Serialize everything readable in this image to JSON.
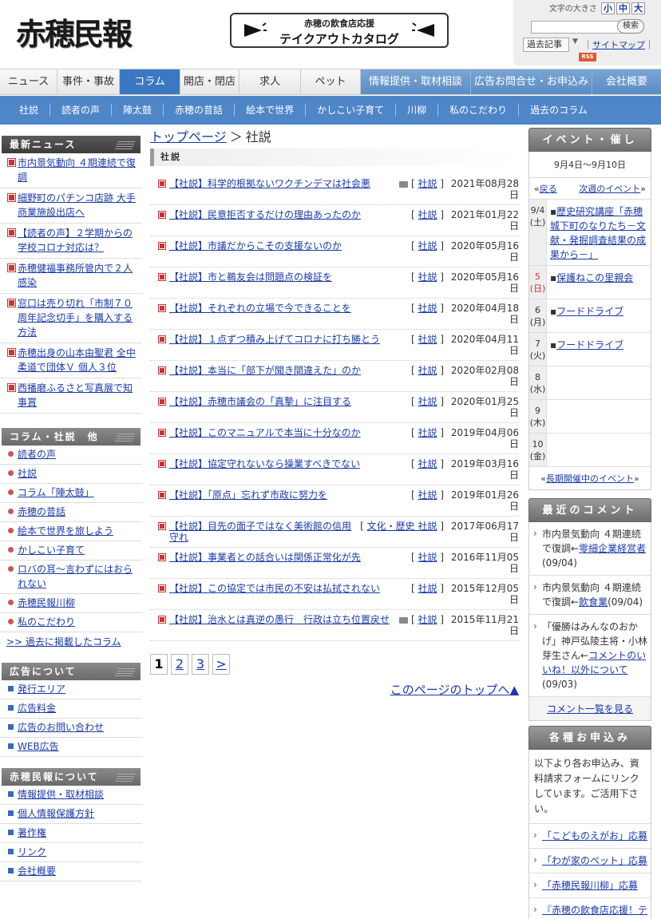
{
  "header": {
    "logo": "赤穂民報",
    "banner_sub": "赤穂の飲食店応援",
    "banner_main": "テイクアウトカタログ",
    "fontsize_label": "文字の大きさ",
    "fontsize_small": "小",
    "fontsize_medium": "中",
    "fontsize_large": "大",
    "search_placeholder": "",
    "search_button": "検索",
    "archive_label": "過去記事",
    "sitemap": "サイトマップ",
    "rss": "RSS"
  },
  "mainnav": [
    "ニュース",
    "事件・事故",
    "コラム",
    "開店・閉店",
    "求人",
    "ペット",
    "情報提供・取材相談",
    "広告お問合せ・お申込み",
    "会社概要"
  ],
  "subnav": [
    "社説",
    "読者の声",
    "陣太鼓",
    "赤穂の昔話",
    "絵本で世界",
    "かしこい子育て",
    "川柳",
    "私のこだわり",
    "過去のコラム"
  ],
  "left": {
    "news_title": "最新ニュース",
    "news": [
      "市内景気動向 ４期連続で復調",
      "細野町のパチンコ店跡 大手商業施設出店へ",
      "【読者の声】２学期からの学校コロナ対応は？",
      "赤穂健福事務所管内で２人感染",
      "窓口は売り切れ「市制７０周年記念切手」を購入する方法",
      "赤穂出身の山本由聖君 全中柔道で団体Ｖ 個人３位",
      "西播磨ふるさと写真展で知事賞"
    ],
    "column_title": "コラム・社説　他",
    "columns": [
      "読者の声",
      "社説",
      "コラム「陣太鼓」",
      "赤穂の昔話",
      "絵本で世界を旅しよう",
      "かしこい子育て",
      "ロバの耳～言わずにはおられない",
      "赤穂民報川柳",
      "私のこだわり"
    ],
    "past_columns": ">> 過去に掲載したコラム",
    "ad_title": "広告について",
    "ads": [
      "発行エリア",
      "広告料金",
      "広告のお問い合わせ",
      "WEB広告"
    ],
    "about_title": "赤穂民報について",
    "about": [
      "情報提供・取材相談",
      "個人情報保護方針",
      "著作権",
      "リンク",
      "会社概要"
    ]
  },
  "center": {
    "breadcrumb_home": "トップページ",
    "breadcrumb_sep": "＞",
    "breadcrumb_current": "社説",
    "section_title": "社説",
    "articles": [
      {
        "title": "【社説】科学的根拠ないワクチンデマは社会悪",
        "cat": "社説",
        "date": "2021年08月28日",
        "photo": true
      },
      {
        "title": "【社説】民意拒否するだけの理由あったのか",
        "cat": "社説",
        "date": "2021年01月22日",
        "photo": false
      },
      {
        "title": "【社説】市議だからこその支援ないのか",
        "cat": "社説",
        "date": "2020年05月16日",
        "photo": false
      },
      {
        "title": "【社説】市と鵜友会は問題点の検証を",
        "cat": "社説",
        "date": "2020年05月16日",
        "photo": false
      },
      {
        "title": "【社説】それぞれの立場で今できることを",
        "cat": "社説",
        "date": "2020年04月18日",
        "photo": false
      },
      {
        "title": "【社説】１点ずつ積み上げてコロナに打ち勝とう",
        "cat": "社説",
        "date": "2020年04月11日",
        "photo": false
      },
      {
        "title": "【社説】本当に「部下が聞き間違えた」のか",
        "cat": "社説",
        "date": "2020年02月08日",
        "photo": false
      },
      {
        "title": "【社説】赤穂市議会の「真摯」に注目する",
        "cat": "社説",
        "date": "2020年01月25日",
        "photo": false
      },
      {
        "title": "【社説】このマニュアルで本当に十分なのか",
        "cat": "社説",
        "date": "2019年04月06日",
        "photo": false
      },
      {
        "title": "【社説】協定守れないなら操業すべきでない",
        "cat": "社説",
        "date": "2019年03月16日",
        "photo": false
      },
      {
        "title": "【社説】「原点」忘れず市政に努力を",
        "cat": "社説",
        "date": "2019年01月26日",
        "photo": false
      },
      {
        "title": "【社説】目先の面子ではなく美術館の信用守れ",
        "cat": "文化・歴史 社説",
        "date": "2017年06月17日",
        "photo": false
      },
      {
        "title": "【社説】事業者との話合いは関係正常化が先",
        "cat": "社説",
        "date": "2016年11月05日",
        "photo": false
      },
      {
        "title": "【社説】この協定では市民の不安は払拭されない",
        "cat": "社説",
        "date": "2015年12月05日",
        "photo": false
      },
      {
        "title": "【社説】治水とは真逆の愚行　行政は立ち位置戻せ",
        "cat": "社説",
        "date": "2015年11月21日",
        "photo": true
      }
    ],
    "pages": [
      "1",
      "2",
      "3",
      ">"
    ],
    "page_top": "このページのトップへ▲"
  },
  "right": {
    "event_title": "イベント・催し",
    "event_range": "9月4日～9月10日",
    "event_prev": "戻る",
    "event_next": "次週のイベント",
    "events": [
      {
        "day": "9/4",
        "dow": "(土)",
        "text": "歴史研究講座「赤穂城下町のなりたち－文献・発掘調査結果の成果から－」",
        "sun": false
      },
      {
        "day": "5",
        "dow": "(日)",
        "text": "保護ねこの里親会",
        "sun": true
      },
      {
        "day": "6",
        "dow": "(月)",
        "text": "フードドライブ",
        "sun": false
      },
      {
        "day": "7",
        "dow": "(火)",
        "text": "フードドライブ",
        "sun": false
      },
      {
        "day": "8",
        "dow": "(水)",
        "text": "",
        "sun": false
      },
      {
        "day": "9",
        "dow": "(木)",
        "text": "",
        "sun": false
      },
      {
        "day": "10",
        "dow": "(金)",
        "text": "",
        "sun": false
      }
    ],
    "event_more": "長期開催中のイベント",
    "comment_title": "最近のコメント",
    "comments": [
      {
        "pre": "市内景気動向 ４期連続で復調←",
        "link": "零細企業経営者",
        "date": "(09/04)"
      },
      {
        "pre": "市内景気動向 ４期連続で復調←",
        "link": "飲食業",
        "date": "(09/04)"
      },
      {
        "pre": "「優勝はみんなのおかげ」神戸弘陵主将・小林芽生さん←",
        "link": "コメントのいいね！以外について",
        "date": "(09/03)"
      }
    ],
    "comment_more": "コメント一覧を見る",
    "apply_title": "各種お申込み",
    "apply_text": "以下より各お申込み、資料請求フォームにリンクしています。ご活用下さい。",
    "apply_items": [
      "「こどものえがお」応募",
      "「わが家のペット」応募",
      "「赤穂民報川柳」応募",
      "『赤穂の飲食店応援！テイクアウトカタログ』"
    ]
  }
}
